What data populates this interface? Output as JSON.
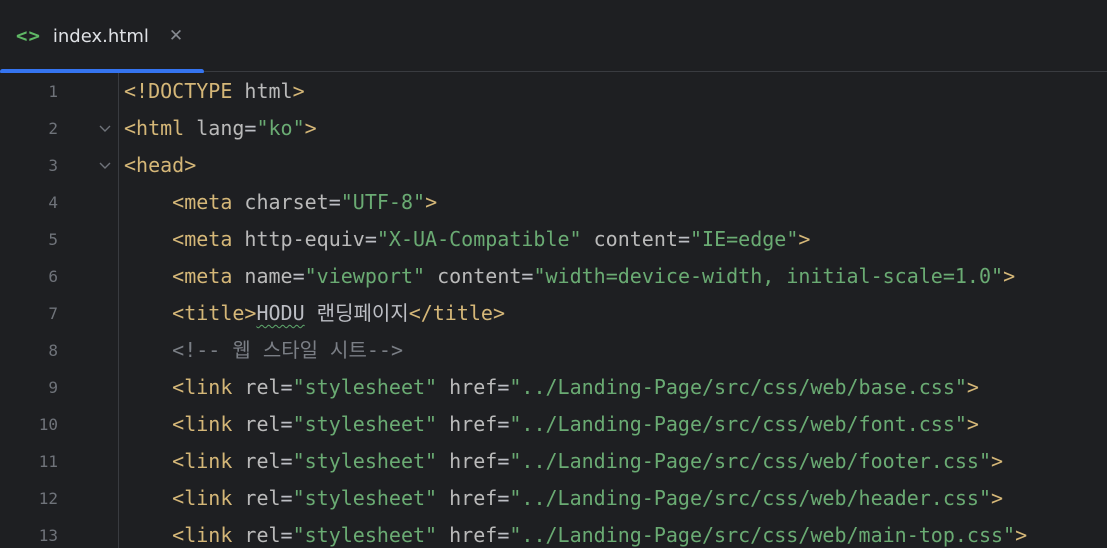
{
  "tab": {
    "icon": "html-tag-icon",
    "icon_glyph": "<>",
    "file_name": "index.html",
    "close_glyph": "✕"
  },
  "colors": {
    "background": "#1e1f22",
    "tag": "#d5b778",
    "attribute": "#bababa",
    "string": "#6aab73",
    "comment": "#7a7e85",
    "line_number": "#6f737a",
    "active_tab_underline": "#3574f0",
    "file_icon": "#5fb865"
  },
  "editor": {
    "lines": [
      {
        "num": "1",
        "fold": false,
        "segments": [
          {
            "t": "tg",
            "v": "<!DOCTYPE "
          },
          {
            "t": "at",
            "v": "html"
          },
          {
            "t": "tg",
            "v": ">"
          }
        ]
      },
      {
        "num": "2",
        "fold": true,
        "segments": [
          {
            "t": "tg",
            "v": "<html "
          },
          {
            "t": "at",
            "v": "lang"
          },
          {
            "t": "tx",
            "v": "="
          },
          {
            "t": "st",
            "v": "\"ko\""
          },
          {
            "t": "tg",
            "v": ">"
          }
        ]
      },
      {
        "num": "3",
        "fold": true,
        "segments": [
          {
            "t": "tg",
            "v": "<head>"
          }
        ]
      },
      {
        "num": "4",
        "fold": false,
        "segments": [
          {
            "t": "tx",
            "v": "    "
          },
          {
            "t": "tg",
            "v": "<meta "
          },
          {
            "t": "at",
            "v": "charset"
          },
          {
            "t": "tx",
            "v": "="
          },
          {
            "t": "st",
            "v": "\"UTF-8\""
          },
          {
            "t": "tg",
            "v": ">"
          }
        ]
      },
      {
        "num": "5",
        "fold": false,
        "segments": [
          {
            "t": "tx",
            "v": "    "
          },
          {
            "t": "tg",
            "v": "<meta "
          },
          {
            "t": "at",
            "v": "http-equiv"
          },
          {
            "t": "tx",
            "v": "="
          },
          {
            "t": "st",
            "v": "\"X-UA-Compatible\""
          },
          {
            "t": "tx",
            "v": " "
          },
          {
            "t": "at",
            "v": "content"
          },
          {
            "t": "tx",
            "v": "="
          },
          {
            "t": "st",
            "v": "\"IE=edge\""
          },
          {
            "t": "tg",
            "v": ">"
          }
        ]
      },
      {
        "num": "6",
        "fold": false,
        "segments": [
          {
            "t": "tx",
            "v": "    "
          },
          {
            "t": "tg",
            "v": "<meta "
          },
          {
            "t": "at",
            "v": "name"
          },
          {
            "t": "tx",
            "v": "="
          },
          {
            "t": "st",
            "v": "\"viewport\""
          },
          {
            "t": "tx",
            "v": " "
          },
          {
            "t": "at",
            "v": "content"
          },
          {
            "t": "tx",
            "v": "="
          },
          {
            "t": "st",
            "v": "\"width=device-width, initial-scale=1.0\""
          },
          {
            "t": "tg",
            "v": ">"
          }
        ]
      },
      {
        "num": "7",
        "fold": false,
        "segments": [
          {
            "t": "tx",
            "v": "    "
          },
          {
            "t": "tg",
            "v": "<title>"
          },
          {
            "t": "tx typo",
            "v": "HODU"
          },
          {
            "t": "tx",
            "v": " 랜딩페이지"
          },
          {
            "t": "tg",
            "v": "</title>"
          }
        ]
      },
      {
        "num": "8",
        "fold": false,
        "segments": [
          {
            "t": "tx",
            "v": "    "
          },
          {
            "t": "cm",
            "v": "<!-- 웹 스타일 시트-->"
          }
        ]
      },
      {
        "num": "9",
        "fold": false,
        "segments": [
          {
            "t": "tx",
            "v": "    "
          },
          {
            "t": "tg",
            "v": "<link "
          },
          {
            "t": "at",
            "v": "rel"
          },
          {
            "t": "tx",
            "v": "="
          },
          {
            "t": "st",
            "v": "\"stylesheet\""
          },
          {
            "t": "tx",
            "v": " "
          },
          {
            "t": "at",
            "v": "href"
          },
          {
            "t": "tx",
            "v": "="
          },
          {
            "t": "st",
            "v": "\"../Landing-Page/src/css/web/base.css\""
          },
          {
            "t": "tg",
            "v": ">"
          }
        ]
      },
      {
        "num": "10",
        "fold": false,
        "segments": [
          {
            "t": "tx",
            "v": "    "
          },
          {
            "t": "tg",
            "v": "<link "
          },
          {
            "t": "at",
            "v": "rel"
          },
          {
            "t": "tx",
            "v": "="
          },
          {
            "t": "st",
            "v": "\"stylesheet\""
          },
          {
            "t": "tx",
            "v": " "
          },
          {
            "t": "at",
            "v": "href"
          },
          {
            "t": "tx",
            "v": "="
          },
          {
            "t": "st",
            "v": "\"../Landing-Page/src/css/web/font.css\""
          },
          {
            "t": "tg",
            "v": ">"
          }
        ]
      },
      {
        "num": "11",
        "fold": false,
        "segments": [
          {
            "t": "tx",
            "v": "    "
          },
          {
            "t": "tg",
            "v": "<link "
          },
          {
            "t": "at",
            "v": "rel"
          },
          {
            "t": "tx",
            "v": "="
          },
          {
            "t": "st",
            "v": "\"stylesheet\""
          },
          {
            "t": "tx",
            "v": " "
          },
          {
            "t": "at",
            "v": "href"
          },
          {
            "t": "tx",
            "v": "="
          },
          {
            "t": "st",
            "v": "\"../Landing-Page/src/css/web/footer.css\""
          },
          {
            "t": "tg",
            "v": ">"
          }
        ]
      },
      {
        "num": "12",
        "fold": false,
        "segments": [
          {
            "t": "tx",
            "v": "    "
          },
          {
            "t": "tg",
            "v": "<link "
          },
          {
            "t": "at",
            "v": "rel"
          },
          {
            "t": "tx",
            "v": "="
          },
          {
            "t": "st",
            "v": "\"stylesheet\""
          },
          {
            "t": "tx",
            "v": " "
          },
          {
            "t": "at",
            "v": "href"
          },
          {
            "t": "tx",
            "v": "="
          },
          {
            "t": "st",
            "v": "\"../Landing-Page/src/css/web/header.css\""
          },
          {
            "t": "tg",
            "v": ">"
          }
        ]
      },
      {
        "num": "13",
        "fold": false,
        "segments": [
          {
            "t": "tx",
            "v": "    "
          },
          {
            "t": "tg",
            "v": "<link "
          },
          {
            "t": "at",
            "v": "rel"
          },
          {
            "t": "tx",
            "v": "="
          },
          {
            "t": "st",
            "v": "\"stylesheet\""
          },
          {
            "t": "tx",
            "v": " "
          },
          {
            "t": "at",
            "v": "href"
          },
          {
            "t": "tx",
            "v": "="
          },
          {
            "t": "st",
            "v": "\"../Landing-Page/src/css/web/main-top.css\""
          },
          {
            "t": "tg",
            "v": ">"
          }
        ]
      }
    ]
  }
}
